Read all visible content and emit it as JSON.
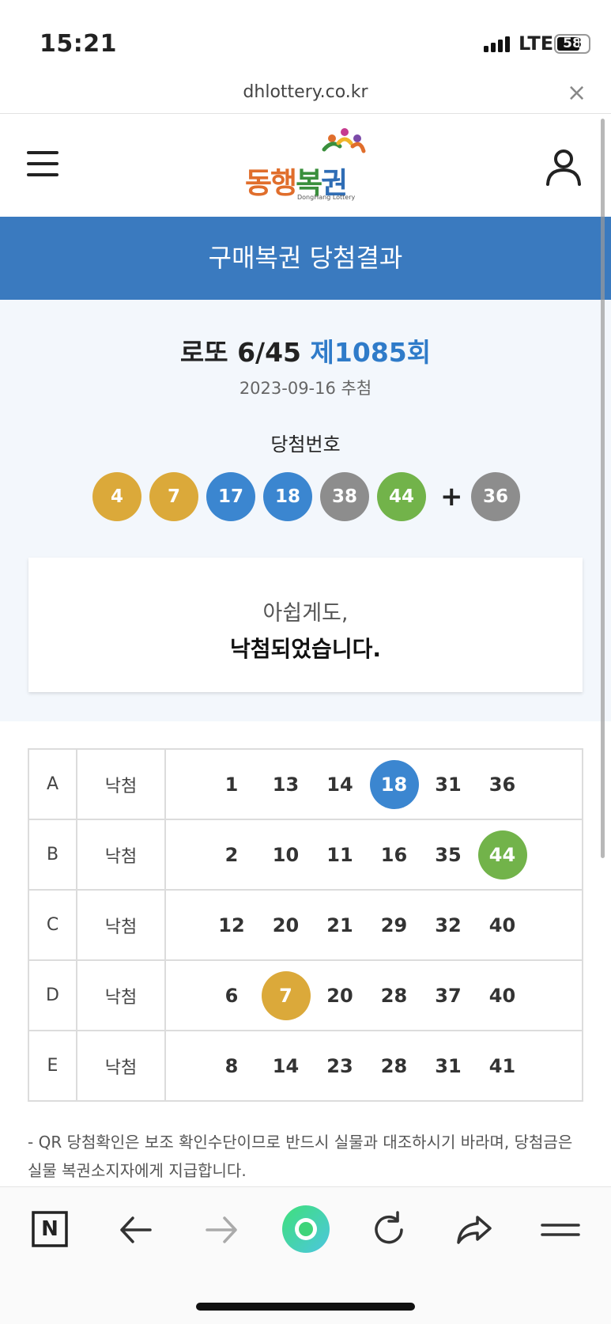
{
  "status_bar": {
    "time": "15:21",
    "network": "LTE",
    "battery": "58"
  },
  "browser": {
    "url": "dhlottery.co.kr",
    "close_glyph": "×"
  },
  "header": {
    "logo_chars": [
      "동",
      "행",
      "복",
      "권"
    ],
    "logo_sub": "DongHang Lottery",
    "menu_icon": "hamburger-menu-icon",
    "user_icon": "user-icon"
  },
  "title": "구매복권 당첨결과",
  "draw": {
    "game": "로또 6/45",
    "round": "제1085회",
    "date": "2023-09-16 추첨",
    "winning_label": "당첨번호",
    "winning_numbers": [
      {
        "value": "4",
        "color": "#dba93a"
      },
      {
        "value": "7",
        "color": "#dba93a"
      },
      {
        "value": "17",
        "color": "#3b86d0"
      },
      {
        "value": "18",
        "color": "#3b86d0"
      },
      {
        "value": "38",
        "color": "#8d8d8d"
      },
      {
        "value": "44",
        "color": "#72b34a"
      }
    ],
    "plus": "+",
    "bonus": {
      "value": "36",
      "color": "#8d8d8d"
    }
  },
  "message": {
    "line1": "아쉽게도,",
    "line2": "낙첨되었습니다."
  },
  "ticket": {
    "rows": [
      {
        "label": "A",
        "result": "낙첨",
        "numbers": [
          "1",
          "13",
          "14",
          "18",
          "31",
          "36"
        ],
        "hits": [
          3
        ],
        "hit_colors": [
          "#3b86d0"
        ]
      },
      {
        "label": "B",
        "result": "낙첨",
        "numbers": [
          "2",
          "10",
          "11",
          "16",
          "35",
          "44"
        ],
        "hits": [
          5
        ],
        "hit_colors": [
          "#72b34a"
        ]
      },
      {
        "label": "C",
        "result": "낙첨",
        "numbers": [
          "12",
          "20",
          "21",
          "29",
          "32",
          "40"
        ],
        "hits": [],
        "hit_colors": []
      },
      {
        "label": "D",
        "result": "낙첨",
        "numbers": [
          "6",
          "7",
          "20",
          "28",
          "37",
          "40"
        ],
        "hits": [
          1
        ],
        "hit_colors": [
          "#dba93a"
        ]
      },
      {
        "label": "E",
        "result": "낙첨",
        "numbers": [
          "8",
          "14",
          "23",
          "28",
          "31",
          "41"
        ],
        "hits": [],
        "hit_colors": []
      }
    ]
  },
  "notice": "- QR 당첨확인은 보조 확인수단이므로 반드시 실물과 대조하시기 바라며, 당첨금은 실물 복권소지자에게 지급합니다.",
  "bottom_nav": {
    "items": [
      "naver-home-icon",
      "back-arrow-icon",
      "forward-arrow-icon",
      "green-dot-button-icon",
      "reload-icon",
      "share-icon",
      "menu-lines-icon"
    ],
    "n_glyph": "N"
  },
  "colors": {
    "brand_blue": "#3a7abf",
    "round_blue": "#2f7bc9",
    "section_bg": "#f3f7fc"
  }
}
